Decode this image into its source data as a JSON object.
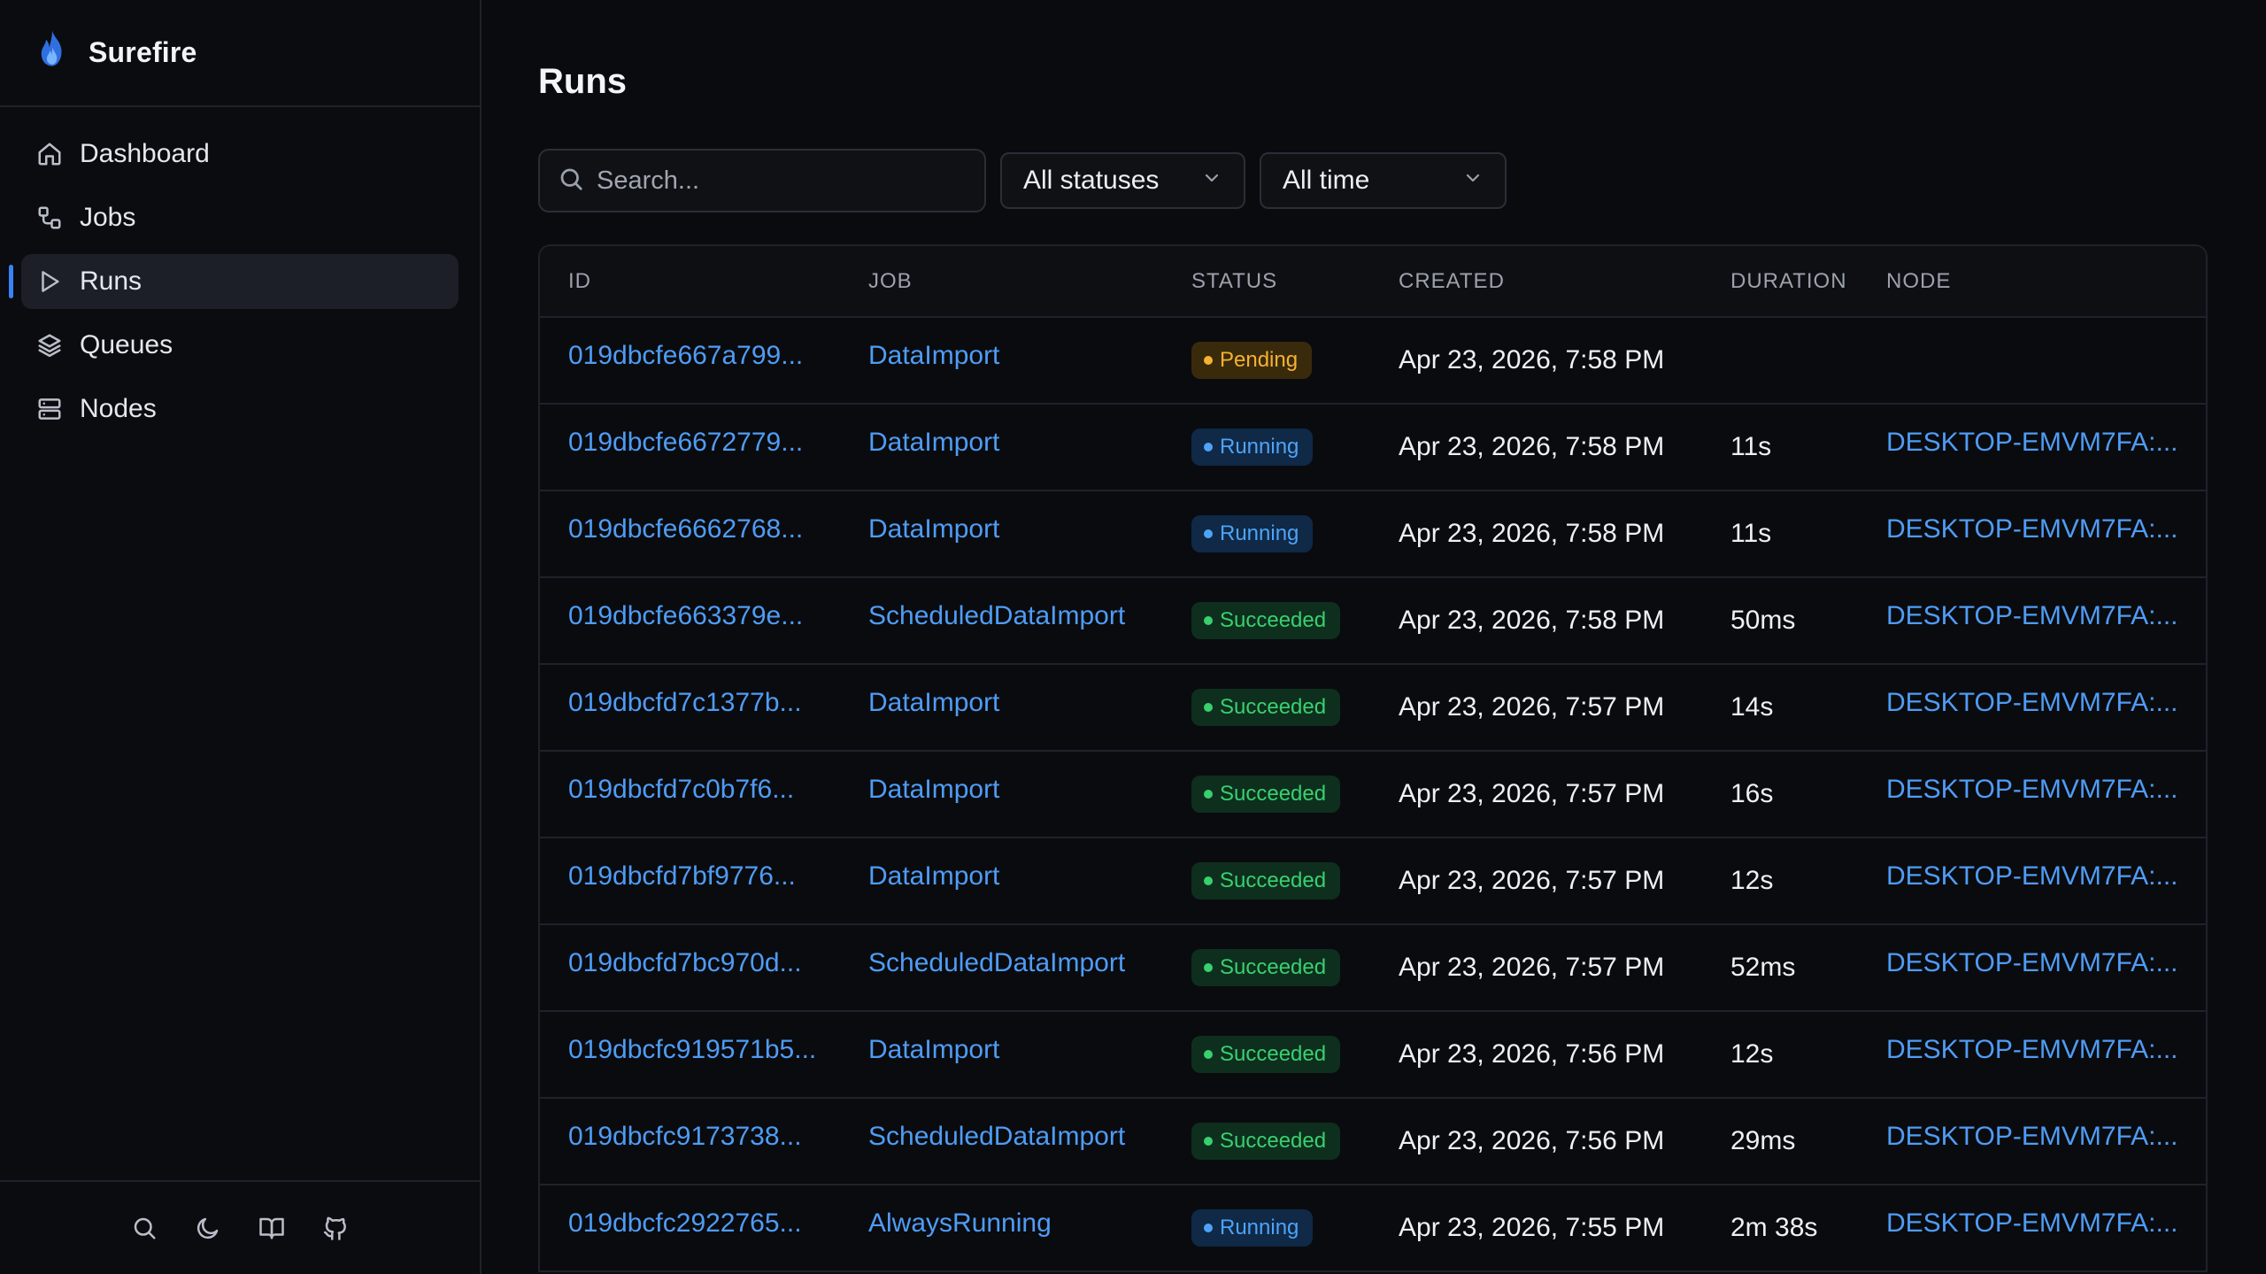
{
  "brand": {
    "name": "Surefire",
    "accent": "#3b82f6"
  },
  "sidebar": {
    "items": [
      {
        "label": "Dashboard",
        "icon": "home-icon",
        "active": false
      },
      {
        "label": "Jobs",
        "icon": "workflow-icon",
        "active": false
      },
      {
        "label": "Runs",
        "icon": "play-icon",
        "active": true
      },
      {
        "label": "Queues",
        "icon": "layers-icon",
        "active": false
      },
      {
        "label": "Nodes",
        "icon": "server-icon",
        "active": false
      }
    ],
    "footer": [
      "search-icon",
      "moon-icon",
      "book-open-icon",
      "github-icon"
    ]
  },
  "page": {
    "title": "Runs"
  },
  "filters": {
    "search_placeholder": "Search...",
    "status_value": "All statuses",
    "time_value": "All time"
  },
  "table": {
    "headers": {
      "id": "ID",
      "job": "JOB",
      "status": "STATUS",
      "created": "CREATED",
      "duration": "DURATION",
      "node": "NODE"
    },
    "rows": [
      {
        "id": "019dbcfe667a799...",
        "job": "DataImport",
        "status": "Pending",
        "status_kind": "pending",
        "created": "Apr 23, 2026, 7:58 PM",
        "duration": "",
        "node": ""
      },
      {
        "id": "019dbcfe6672779...",
        "job": "DataImport",
        "status": "Running",
        "status_kind": "running",
        "created": "Apr 23, 2026, 7:58 PM",
        "duration": "11s",
        "node": "DESKTOP-EMVM7FA:..."
      },
      {
        "id": "019dbcfe6662768...",
        "job": "DataImport",
        "status": "Running",
        "status_kind": "running",
        "created": "Apr 23, 2026, 7:58 PM",
        "duration": "11s",
        "node": "DESKTOP-EMVM7FA:..."
      },
      {
        "id": "019dbcfe663379e...",
        "job": "ScheduledDataImport",
        "status": "Succeeded",
        "status_kind": "succeeded",
        "created": "Apr 23, 2026, 7:58 PM",
        "duration": "50ms",
        "node": "DESKTOP-EMVM7FA:..."
      },
      {
        "id": "019dbcfd7c1377b...",
        "job": "DataImport",
        "status": "Succeeded",
        "status_kind": "succeeded",
        "created": "Apr 23, 2026, 7:57 PM",
        "duration": "14s",
        "node": "DESKTOP-EMVM7FA:..."
      },
      {
        "id": "019dbcfd7c0b7f6...",
        "job": "DataImport",
        "status": "Succeeded",
        "status_kind": "succeeded",
        "created": "Apr 23, 2026, 7:57 PM",
        "duration": "16s",
        "node": "DESKTOP-EMVM7FA:..."
      },
      {
        "id": "019dbcfd7bf9776...",
        "job": "DataImport",
        "status": "Succeeded",
        "status_kind": "succeeded",
        "created": "Apr 23, 2026, 7:57 PM",
        "duration": "12s",
        "node": "DESKTOP-EMVM7FA:..."
      },
      {
        "id": "019dbcfd7bc970d...",
        "job": "ScheduledDataImport",
        "status": "Succeeded",
        "status_kind": "succeeded",
        "created": "Apr 23, 2026, 7:57 PM",
        "duration": "52ms",
        "node": "DESKTOP-EMVM7FA:..."
      },
      {
        "id": "019dbcfc919571b5...",
        "job": "DataImport",
        "status": "Succeeded",
        "status_kind": "succeeded",
        "created": "Apr 23, 2026, 7:56 PM",
        "duration": "12s",
        "node": "DESKTOP-EMVM7FA:..."
      },
      {
        "id": "019dbcfc9173738...",
        "job": "ScheduledDataImport",
        "status": "Succeeded",
        "status_kind": "succeeded",
        "created": "Apr 23, 2026, 7:56 PM",
        "duration": "29ms",
        "node": "DESKTOP-EMVM7FA:..."
      },
      {
        "id": "019dbcfc2922765...",
        "job": "AlwaysRunning",
        "status": "Running",
        "status_kind": "running",
        "created": "Apr 23, 2026, 7:55 PM",
        "duration": "2m 38s",
        "node": "DESKTOP-EMVM7FA:..."
      }
    ]
  },
  "colors": {
    "link": "#4f9cf5",
    "pending": "#f5b233",
    "running": "#4fa3f7",
    "succeeded": "#39d06f"
  }
}
